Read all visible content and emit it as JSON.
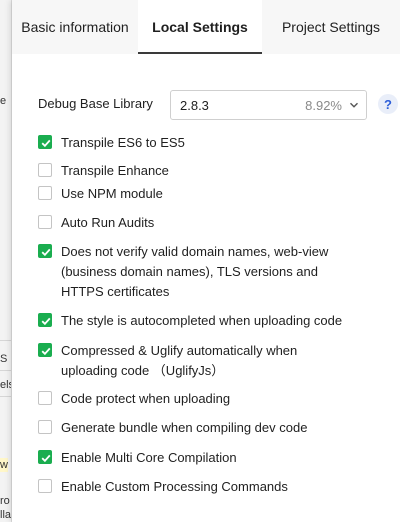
{
  "background": {
    "fragments": [
      "e",
      "S",
      "els",
      "w",
      "ro",
      "lla"
    ]
  },
  "tabs": [
    {
      "label": "Basic information",
      "active": false
    },
    {
      "label": "Local Settings",
      "active": true
    },
    {
      "label": "Project Settings",
      "active": false
    }
  ],
  "debug_library": {
    "label": "Debug Base Library",
    "version": "2.8.3",
    "share": "8.92%",
    "help": "?"
  },
  "options": [
    {
      "label": "Transpile ES6 to ES5",
      "checked": true
    },
    {
      "label": "Transpile Enhance",
      "checked": false
    },
    {
      "label": "Use NPM module",
      "checked": false
    },
    {
      "label": "Auto Run Audits",
      "checked": false
    },
    {
      "label": "Does not verify valid domain names, web-view\n(business domain names), TLS versions and\nHTTPS certificates",
      "checked": true
    },
    {
      "label": "The style is autocompleted when uploading code",
      "checked": true
    },
    {
      "label": "Compressed & Uglify automatically when\nuploading code （UglifyJs）",
      "checked": true
    },
    {
      "label": "Code protect when uploading",
      "checked": false
    },
    {
      "label": "Generate bundle when compiling dev code",
      "checked": false
    },
    {
      "label": "Enable Multi Core Compilation",
      "checked": true
    },
    {
      "label": "Enable Custom Processing Commands",
      "checked": false
    }
  ],
  "colors": {
    "checked": "#1aad4f",
    "help_accent": "#2d5ed9"
  }
}
